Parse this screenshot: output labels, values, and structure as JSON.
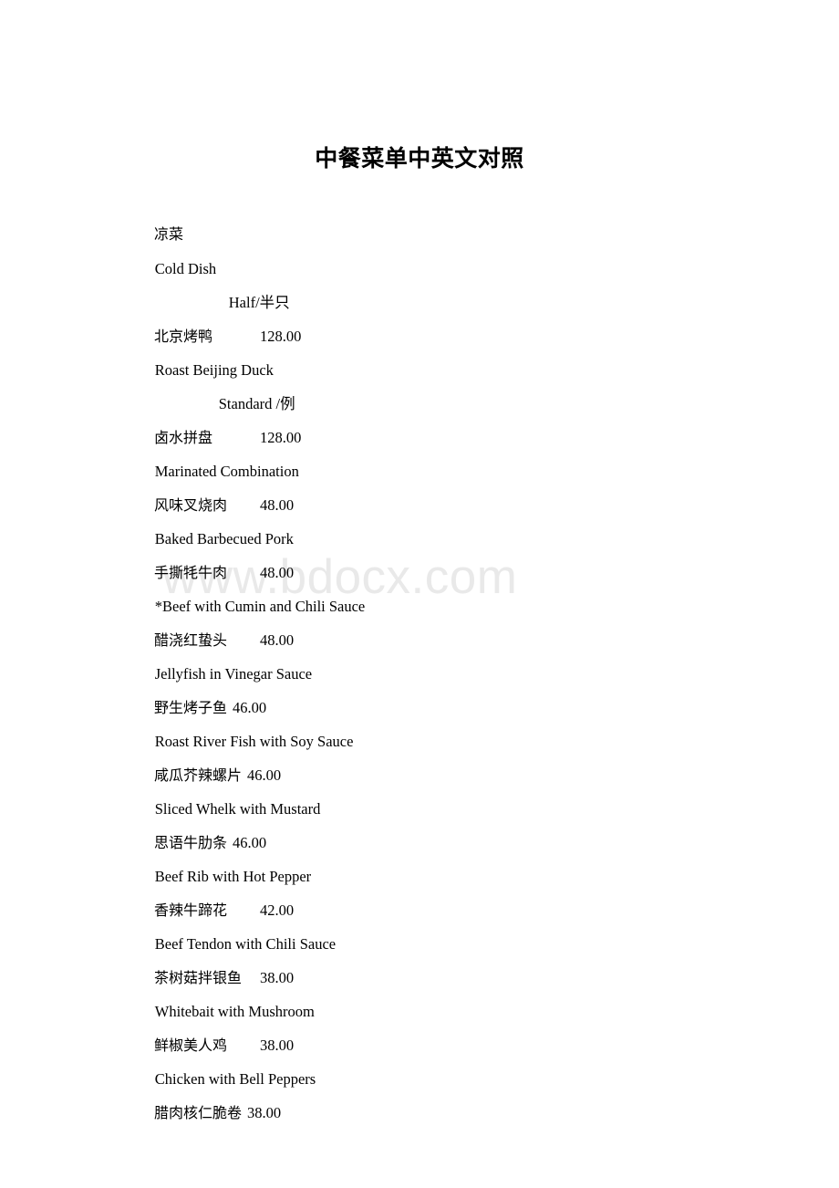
{
  "document": {
    "title": "中餐菜单中英文对照",
    "watermark": "www.bdocx.com"
  },
  "menu": {
    "category_zh": "凉菜",
    "category_en": "Cold Dish",
    "portion_half": "Half/半只",
    "portion_standard": "Standard /例",
    "items": [
      {
        "name_zh": "北京烤鸭",
        "price": "128.00",
        "name_en": "Roast Beijing Duck"
      },
      {
        "name_zh": "卤水拼盘",
        "price": "128.00",
        "name_en": "Marinated Combination"
      },
      {
        "name_zh": "风味叉烧肉",
        "price": "48.00",
        "name_en": "Baked Barbecued Pork"
      },
      {
        "name_zh": "手撕牦牛肉",
        "price": "48.00",
        "name_en": "*Beef with Cumin and Chili Sauce"
      },
      {
        "name_zh": "醋浇红蛰头",
        "price": "48.00",
        "name_en": "Jellyfish in Vinegar Sauce"
      },
      {
        "name_zh": "野生烤子鱼",
        "price": "46.00",
        "name_en": "Roast River Fish with Soy Sauce"
      },
      {
        "name_zh": "咸瓜芥辣螺片",
        "price": "46.00",
        "name_en": "Sliced Whelk with Mustard"
      },
      {
        "name_zh": "思语牛肋条",
        "price": "46.00",
        "name_en": "Beef Rib with Hot Pepper"
      },
      {
        "name_zh": "香辣牛蹄花",
        "price": "42.00",
        "name_en": "Beef Tendon with Chili Sauce"
      },
      {
        "name_zh": "茶树菇拌银鱼",
        "price": "38.00",
        "name_en": "Whitebait with Mushroom"
      },
      {
        "name_zh": "鲜椒美人鸡",
        "price": "38.00",
        "name_en": "Chicken with Bell Peppers"
      },
      {
        "name_zh": "腊肉核仁脆卷",
        "price": "38.00",
        "name_en": null
      }
    ]
  }
}
